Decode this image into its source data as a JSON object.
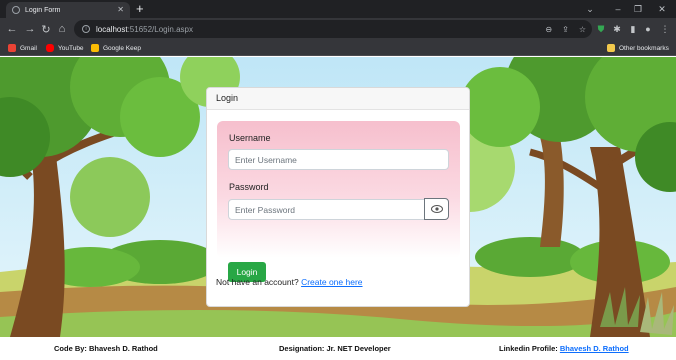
{
  "browser": {
    "tab_title": "Login Form",
    "url_host": "localhost",
    "url_path": ":51652/Login.aspx",
    "bookmarks": [
      {
        "label": "Gmail",
        "color": "#ea4335"
      },
      {
        "label": "YouTube",
        "color": "#ff0000"
      },
      {
        "label": "Google Keep",
        "color": "#fbbc04"
      }
    ],
    "other_bookmarks": "Other bookmarks"
  },
  "login": {
    "card_title": "Login",
    "username_label": "Username",
    "username_placeholder": "Enter Username",
    "password_label": "Password",
    "password_placeholder": "Enter Password",
    "login_button": "Login",
    "signup_prompt": "Not have an account?",
    "signup_link": "Create one here"
  },
  "footer": {
    "code_by": "Code By: Bhavesh D. Rathod",
    "designation": "Designation: Jr. NET Developer",
    "linkedin_label": "Linkedin Profile:",
    "linkedin_link": "Bhavesh D. Rathod"
  },
  "colors": {
    "accent_green": "#28a745",
    "link_blue": "#0d6efd",
    "panel_pink": "#f6bfcd"
  }
}
